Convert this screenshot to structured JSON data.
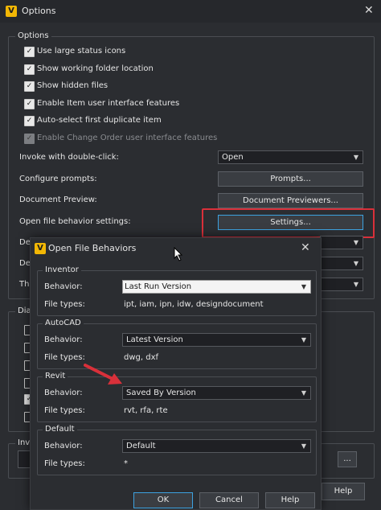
{
  "window": {
    "title": "Options",
    "app_icon": "V",
    "close": "✕"
  },
  "options_group": {
    "label": "Options",
    "checkboxes": [
      {
        "label": "Use large status icons",
        "checked": true
      },
      {
        "label": "Show working folder location",
        "checked": true
      },
      {
        "label": "Show hidden files",
        "checked": true
      },
      {
        "label": "Enable Item user interface features",
        "checked": true
      },
      {
        "label": "Auto-select first duplicate item",
        "checked": true
      },
      {
        "label": "Enable Change Order user interface features",
        "checked": true,
        "disabled": true
      }
    ],
    "rows": {
      "invoke_label": "Invoke with double-click:",
      "invoke_value": "Open",
      "prompts_label": "Configure prompts:",
      "prompts_button": "Prompts...",
      "preview_label": "Document Preview:",
      "preview_button": "Document Previewers...",
      "open_behavior_label": "Open file behavior settings:",
      "open_behavior_button": "Settings...",
      "de1_label": "De",
      "de2_label": "De",
      "th_label": "The"
    }
  },
  "dia_group": {
    "label": "Dia"
  },
  "inv_group": {
    "label": "Inv",
    "browse": "..."
  },
  "main_help_button": "Help",
  "dialog": {
    "title": "Open File Behaviors",
    "app_icon": "V",
    "close": "✕",
    "inventor": {
      "label": "Inventor",
      "behavior_label": "Behavior:",
      "behavior_value": "Last Run Version",
      "filetypes_label": "File types:",
      "filetypes_value": "ipt, iam, ipn, idw, designdocument"
    },
    "autocad": {
      "label": "AutoCAD",
      "behavior_label": "Behavior:",
      "behavior_value": "Latest Version",
      "filetypes_label": "File types:",
      "filetypes_value": "dwg, dxf"
    },
    "revit": {
      "label": "Revit",
      "behavior_label": "Behavior:",
      "behavior_value": "Saved By Version",
      "filetypes_label": "File types:",
      "filetypes_value": "rvt, rfa, rte"
    },
    "default": {
      "label": "Default",
      "behavior_label": "Behavior:",
      "behavior_value": "Default",
      "filetypes_label": "File types:",
      "filetypes_value": "*"
    },
    "ok_button": "OK",
    "cancel_button": "Cancel",
    "help_button": "Help"
  },
  "colors": {
    "highlight": "#d9303a",
    "focus": "#3da2e0",
    "accent": "#f2b705"
  }
}
